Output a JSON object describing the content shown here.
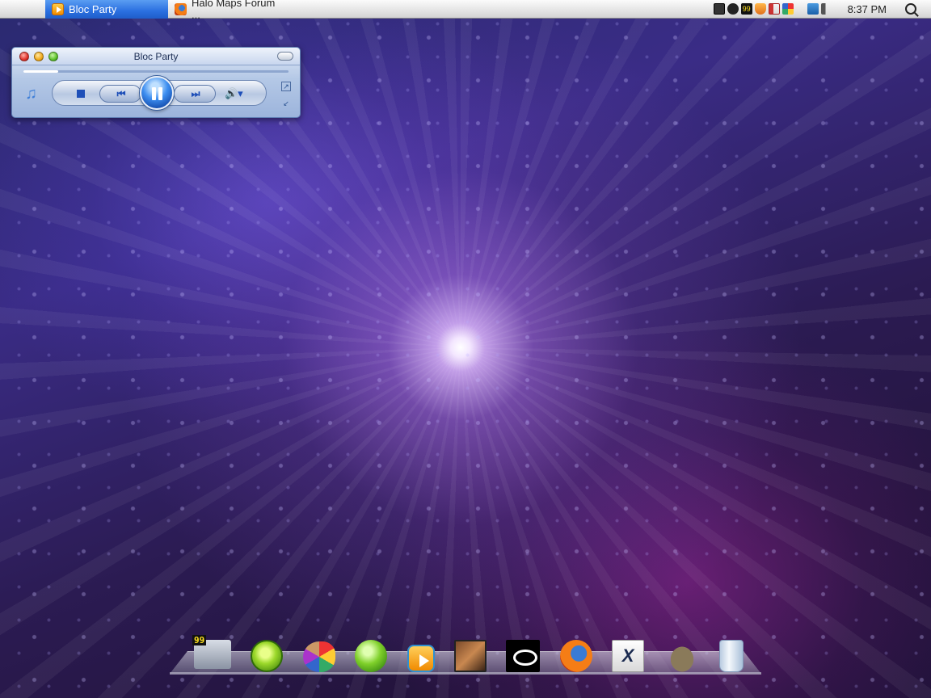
{
  "menubar": {
    "apple_glyph": "",
    "tasks": [
      {
        "label": "Bloc Party",
        "icon": "media-player-icon",
        "active": true
      },
      {
        "label": "Halo Maps Forum ...",
        "icon": "firefox-icon",
        "active": false
      }
    ],
    "tray_icons": [
      "network-icon",
      "steam-icon",
      "xfire-icon",
      "shield-icon",
      "volume-icon",
      "paint-icon",
      "display-icon",
      "speaker-icon"
    ],
    "clock": "8:37 PM"
  },
  "player": {
    "title": "Bloc Party",
    "seek_progress": 0.13,
    "prev_glyph": "⏮",
    "next_glyph": "⏭",
    "volume_glyph": "🔊▾",
    "note_glyph": "♫"
  },
  "dock": {
    "items": [
      {
        "name": "xfire-monitor",
        "badge": "99"
      },
      {
        "name": "limewire"
      },
      {
        "name": "paint-tools"
      },
      {
        "name": "green-orb"
      },
      {
        "name": "media-player"
      },
      {
        "name": "avatar"
      },
      {
        "name": "steam"
      },
      {
        "name": "firefox"
      },
      {
        "name": "xfire-x",
        "glyph": "X"
      },
      {
        "name": "gimp"
      },
      {
        "name": "recycle-bin"
      }
    ]
  },
  "colors": {
    "accent": "#2a6fe0",
    "player_blue": "#1e4fb8"
  }
}
